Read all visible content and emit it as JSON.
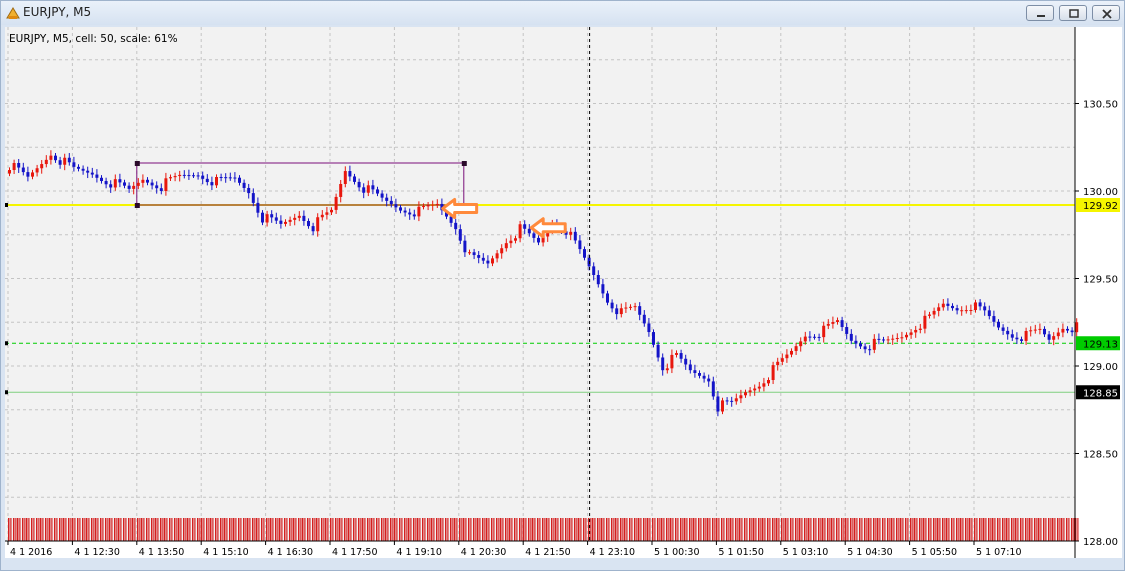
{
  "window": {
    "title": "EURJPY, M5",
    "buttons": [
      "minimize",
      "restore",
      "close"
    ]
  },
  "chart_label": "EURJPY, M5, cell: 50, scale: 61%",
  "colors": {
    "background": "#f2f2f2",
    "grid": "#c4c4c4",
    "bull": "#e8170d",
    "bear": "#1414c8",
    "resistance": "#f5f500",
    "box": "#7a0f7a",
    "current_price": "#00cc00",
    "arrow": "#ff8a3c",
    "volume": "#d41f1f"
  },
  "chart_data": {
    "type": "candlestick",
    "symbol": "EURJPY",
    "timeframe": "M5",
    "ylim": [
      128.0,
      130.75
    ],
    "y_ticks": [
      "130.50",
      "130.00",
      "129.50",
      "129.00",
      "128.50",
      "128.00"
    ],
    "x_ticks": [
      "4 1 2016",
      "4 1 12:30",
      "4 1 13:50",
      "4 1 15:10",
      "4 1 16:30",
      "4 1 17:50",
      "4 1 19:10",
      "4 1 20:30",
      "4 1 21:50",
      "4 1 23:10",
      "5 1 00:30",
      "5 1 01:50",
      "5 1 03:10",
      "5 1 04:30",
      "5 1 05:50",
      "5 1 07:10"
    ],
    "price_labels": [
      {
        "text": "129.92",
        "value": 129.92,
        "style": "yellow"
      },
      {
        "text": "129.13",
        "value": 129.13,
        "style": "green"
      },
      {
        "text": "128.85",
        "value": 128.85,
        "style": "black"
      }
    ],
    "levels": [
      {
        "value": 129.92,
        "style": "solid-yellow"
      },
      {
        "value": 129.13,
        "style": "dashed-green"
      },
      {
        "value": 128.85,
        "style": "thin-green"
      }
    ],
    "rectangle": {
      "from": "4 1 13:50",
      "to": "4 1 20:30",
      "high": 130.16,
      "low": 129.92
    },
    "arrows": [
      {
        "at": "4 1 20:00",
        "value": 129.9
      },
      {
        "at": "4 1 21:50",
        "value": 129.79
      }
    ],
    "crosshair_time": "4 1 23:10",
    "close_path": [
      [
        0,
        130.15
      ],
      [
        4,
        130.07
      ],
      [
        9,
        130.22
      ],
      [
        14,
        130.12
      ],
      [
        18,
        130.1
      ],
      [
        22,
        130.05
      ],
      [
        26,
        130.0
      ],
      [
        29,
        130.07
      ],
      [
        33,
        130.03
      ],
      [
        37,
        130.08
      ],
      [
        41,
        130.1
      ],
      [
        45,
        130.05
      ],
      [
        49,
        130.07
      ],
      [
        52,
        130.0
      ],
      [
        55,
        129.85
      ],
      [
        59,
        129.8
      ],
      [
        63,
        129.87
      ],
      [
        66,
        129.8
      ],
      [
        70,
        129.88
      ],
      [
        73,
        130.12
      ],
      [
        77,
        130.02
      ],
      [
        81,
        129.95
      ],
      [
        85,
        129.9
      ],
      [
        89,
        129.88
      ],
      [
        93,
        129.92
      ],
      [
        97,
        129.8
      ],
      [
        100,
        129.62
      ],
      [
        104,
        129.58
      ],
      [
        108,
        129.72
      ],
      [
        111,
        129.78
      ],
      [
        115,
        129.7
      ],
      [
        118,
        129.82
      ],
      [
        121,
        129.78
      ],
      [
        124,
        129.65
      ],
      [
        127,
        129.52
      ],
      [
        130,
        129.38
      ],
      [
        133,
        129.3
      ],
      [
        136,
        129.33
      ],
      [
        139,
        129.2
      ],
      [
        142,
        129.0
      ],
      [
        145,
        129.05
      ],
      [
        148,
        128.97
      ],
      [
        152,
        128.93
      ],
      [
        154,
        128.77
      ],
      [
        157,
        128.78
      ],
      [
        160,
        128.85
      ],
      [
        163,
        128.9
      ],
      [
        167,
        129.0
      ],
      [
        170,
        129.08
      ],
      [
        173,
        129.18
      ],
      [
        177,
        129.2
      ],
      [
        180,
        129.25
      ],
      [
        183,
        129.15
      ],
      [
        186,
        129.12
      ],
      [
        190,
        129.13
      ],
      [
        194,
        129.17
      ],
      [
        197,
        129.23
      ],
      [
        200,
        129.27
      ],
      [
        203,
        129.35
      ],
      [
        206,
        129.33
      ],
      [
        209,
        129.35
      ],
      [
        212,
        129.3
      ],
      [
        215,
        129.22
      ],
      [
        218,
        129.18
      ],
      [
        221,
        129.17
      ],
      [
        224,
        129.2
      ],
      [
        226,
        129.15
      ],
      [
        229,
        129.23
      ],
      [
        232,
        129.22
      ]
    ]
  }
}
